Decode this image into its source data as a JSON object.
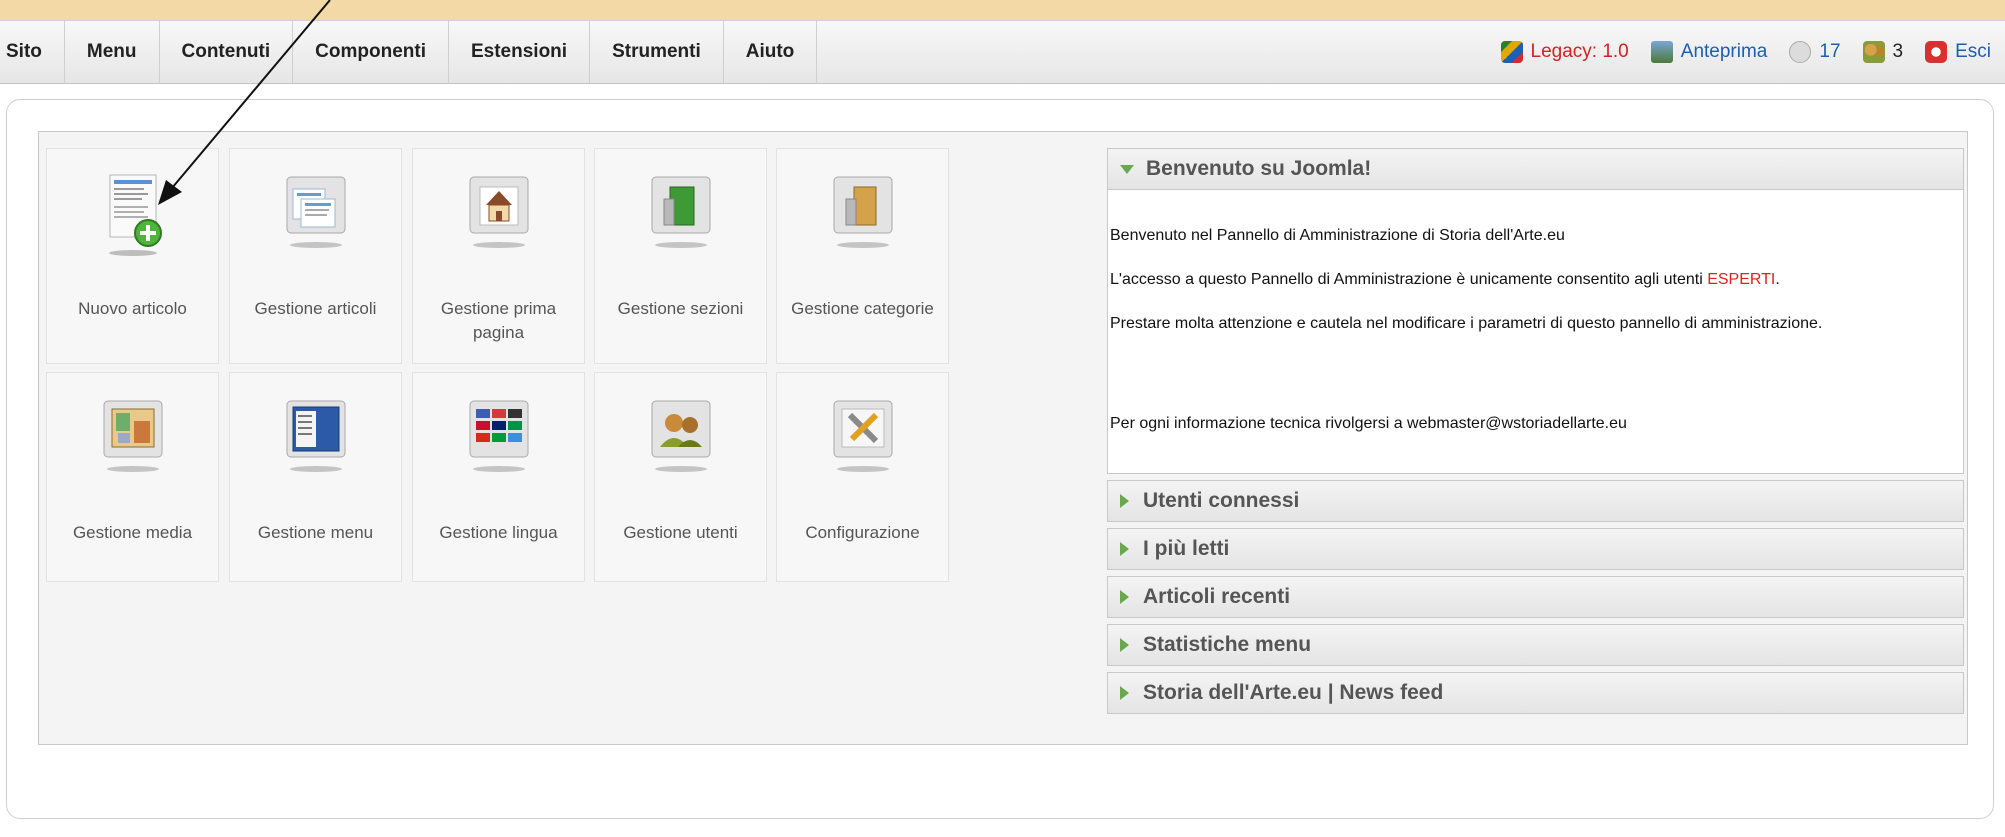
{
  "menu": {
    "items": [
      "Sito",
      "Menu",
      "Contenuti",
      "Componenti",
      "Estensioni",
      "Strumenti",
      "Aiuto"
    ]
  },
  "status": {
    "legacy_label": "Legacy: 1.0",
    "preview_label": "Anteprima",
    "messages_count": "17",
    "users_count": "3",
    "logout_label": "Esci"
  },
  "tiles": [
    {
      "label": "Nuovo articolo",
      "icon": "new-article-icon"
    },
    {
      "label": "Gestione articoli",
      "icon": "articles-icon"
    },
    {
      "label": "Gestione prima pagina",
      "icon": "frontpage-icon"
    },
    {
      "label": "Gestione sezioni",
      "icon": "sections-icon"
    },
    {
      "label": "Gestione categorie",
      "icon": "categories-icon"
    },
    {
      "label": "Gestione media",
      "icon": "media-icon"
    },
    {
      "label": "Gestione menu",
      "icon": "menu-icon"
    },
    {
      "label": "Gestione lingua",
      "icon": "language-icon"
    },
    {
      "label": "Gestione utenti",
      "icon": "users-icon"
    },
    {
      "label": "Configurazione",
      "icon": "configuration-icon"
    }
  ],
  "welcome": {
    "title": "Benvenuto su Joomla!",
    "line1": "Benvenuto nel Pannello di Amministrazione di Storia dell'Arte.eu",
    "line2_prefix": "L'accesso a questo Pannello di Amministrazione è unicamente consentito agli utenti ",
    "line2_highlight": "ESPERTI",
    "line2_suffix": ".",
    "line3": "Prestare molta attenzione e cautela nel modificare i parametri di questo pannello di amministrazione.",
    "line4": "Per ogni informazione tecnica rivolgersi a webmaster@wstoriadellarte.eu"
  },
  "panes": [
    "Utenti connessi",
    "I più letti",
    "Articoli recenti",
    "Statistiche menu",
    "Storia dell'Arte.eu | News feed"
  ],
  "colors": {
    "accent": "#1a5fb4",
    "legacy": "#d22222",
    "arrow": "#6aa84f"
  }
}
